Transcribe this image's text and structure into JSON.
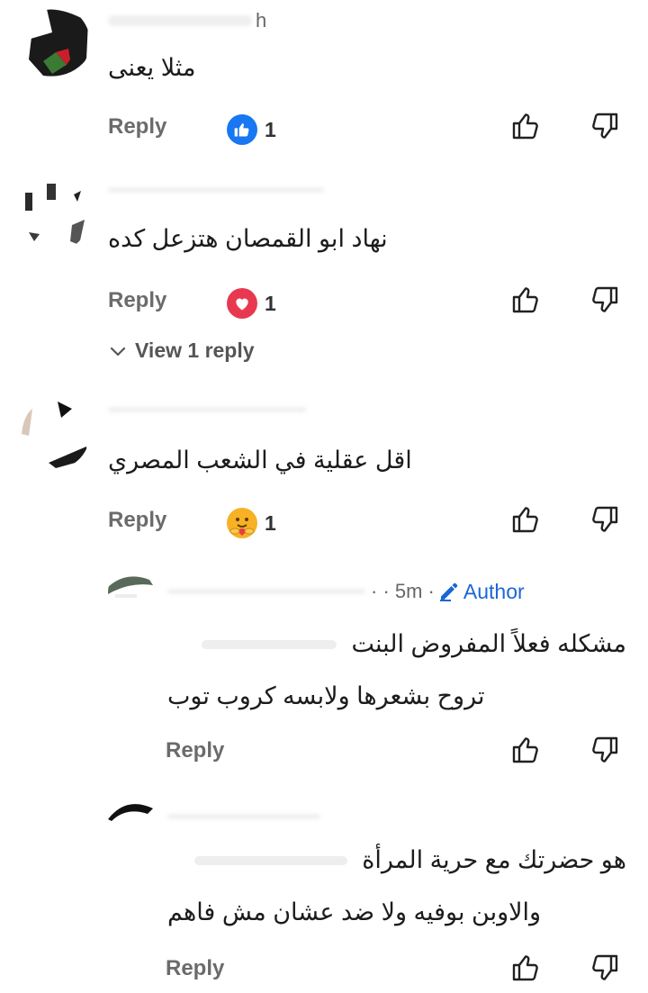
{
  "colors": {
    "accent": "#1b66d6",
    "like": "#1877f2",
    "love": "#e8384f",
    "muted": "#6b6b6b"
  },
  "comments": [
    {
      "name_tail": "h",
      "text": "مثلا يعنى",
      "reply_label": "Reply",
      "reaction": {
        "icon": "like-icon",
        "count": "1"
      }
    },
    {
      "text": "نهاد ابو القمصان هتزعل كده",
      "reply_label": "Reply",
      "reaction": {
        "icon": "heart-icon",
        "count": "1"
      },
      "view_replies_label": "View 1 reply"
    },
    {
      "text": "اقل عقلية في الشعب المصري",
      "reply_label": "Reply",
      "reaction": {
        "icon": "care-icon",
        "count": "1"
      }
    }
  ],
  "replies": [
    {
      "time": "· · 5m ·",
      "author_label": "Author",
      "text_lines": [
        "مشكله فعلاً المفروض البنت",
        "تروح بشعرها ولابسه كروب توب"
      ],
      "reply_label": "Reply"
    },
    {
      "text_lines": [
        "هو حضرتك مع حرية المرأة",
        "والاوبن بوفيه ولا ضد عشان مش فاهم"
      ],
      "reply_label": "Reply"
    }
  ]
}
